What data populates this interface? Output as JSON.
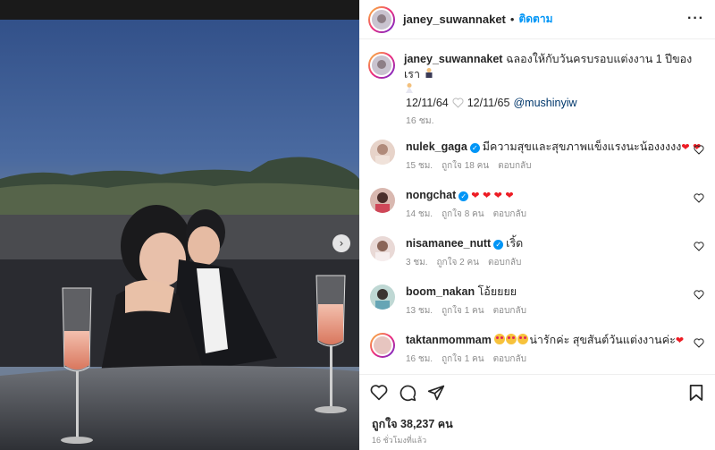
{
  "post": {
    "author": "janey_suwannaket",
    "follow_label": "ติดตาม",
    "more_icon": "more-icon",
    "caption_text": "ฉลองให้กับวันครบรอบแต่งงาน 1 ปีของเรา",
    "date_from": "12/11/64",
    "date_to": "12/11/65",
    "mention": "@mushinyiw",
    "caption_time": "16 ชม."
  },
  "comments": [
    {
      "user": "nulek_gaga",
      "verified": true,
      "text": "มีความสุขและสุขภาพแข็งแรงนะน้องงงงง",
      "hearts": "❤ ❤",
      "time": "15 ชม.",
      "likes": "ถูกใจ 18 คน",
      "reply": "ตอบกลับ"
    },
    {
      "user": "nongchat",
      "verified": true,
      "text": "",
      "hearts": "❤ ❤ ❤ ❤",
      "time": "14 ชม.",
      "likes": "ถูกใจ 8 คน",
      "reply": "ตอบกลับ"
    },
    {
      "user": "nisamanee_nutt",
      "verified": true,
      "text": "เริ้ด",
      "hearts": "",
      "time": "3 ชม.",
      "likes": "ถูกใจ 2 คน",
      "reply": "ตอบกลับ"
    },
    {
      "user": "boom_nakan",
      "verified": false,
      "text": "โอ้ยยยย",
      "hearts": "",
      "time": "13 ชม.",
      "likes": "ถูกใจ 1 คน",
      "reply": "ตอบกลับ"
    },
    {
      "user": "taktanmommam",
      "verified": false,
      "text": "น่ารักค่ะ สุขสันต์วันแต่งงานค่ะ",
      "hearts": "❤",
      "time": "16 ชม.",
      "likes": "ถูกใจ 1 คน",
      "reply": "ตอบกลับ"
    }
  ],
  "footer": {
    "likes_text": "ถูกใจ 38,237 คน",
    "posted_time": "16 ชั่วโมงที่แล้ว"
  },
  "colors": {
    "accent_blue": "#0095f6",
    "verified_blue": "#0095f6",
    "heart_red": "#ed1c24",
    "meta_gray": "#8e8e8e"
  }
}
